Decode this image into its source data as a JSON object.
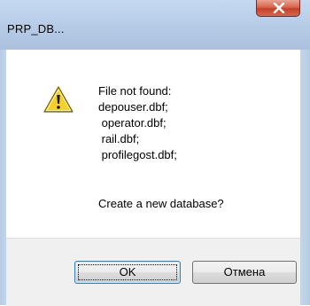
{
  "window": {
    "title": "PRP_DB..."
  },
  "message": {
    "heading": "File not found:",
    "files": [
      "depouser.dbf;",
      " operator.dbf;",
      " rail.dbf;",
      " profilegost.dbf;"
    ],
    "question": "Create a new database?"
  },
  "buttons": {
    "ok_label": "OK",
    "cancel_label": "Отмена"
  },
  "icons": {
    "close": "close-icon",
    "warning": "warning-icon"
  },
  "colors": {
    "close_button": "#c4412a",
    "warning_yellow": "#f7cf2a"
  }
}
